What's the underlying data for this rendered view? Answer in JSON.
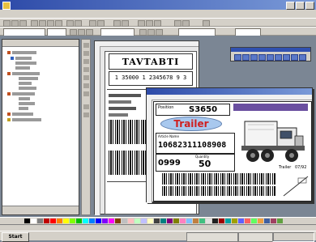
{
  "window": {
    "title": "",
    "buttons": [
      "minimize",
      "maximize",
      "close"
    ]
  },
  "menu": {
    "items": []
  },
  "document1": {
    "header": "TAVTABTI",
    "code_line": "1 35000 1 2345678 9 3",
    "barcode_text": ""
  },
  "document2": {
    "position_label": "Position",
    "position_value": "S3650",
    "badge_label": "Trailer",
    "company_label": "",
    "article_label": "Article Name",
    "article_number": "10682311108908",
    "qty_label": "Quantity",
    "lot_value": "0999",
    "qty_value": "50",
    "trailer_label": "Trailer",
    "trailer_value": "07/92"
  },
  "icons": [
    "app-icon",
    "truck-icon",
    "folder-icon",
    "barcode-icon"
  ],
  "palette_colors": [
    "#000000",
    "#ffffff",
    "#808080",
    "#c00000",
    "#ff0000",
    "#ff8000",
    "#ffff00",
    "#80ff00",
    "#00c000",
    "#00ffff",
    "#0080ff",
    "#0000ff",
    "#8000ff",
    "#ff00ff",
    "#804000",
    "#c0c0c0",
    "#ffc0c0",
    "#c0ffc0",
    "#c0c0ff",
    "#ffffc0",
    "#404040",
    "#008080",
    "#800080",
    "#808000",
    "#ff80c0",
    "#80c0ff",
    "#c08040",
    "#40c080",
    "#e0e0e0",
    "#202020",
    "#a00000",
    "#00a0a0",
    "#a0a000",
    "#6060ff",
    "#ff6060",
    "#60ff60",
    "#f0a040",
    "#4060a0",
    "#a04060",
    "#60a040"
  ],
  "taskbar": {
    "start_label": "Start",
    "items": [
      "",
      ""
    ]
  }
}
